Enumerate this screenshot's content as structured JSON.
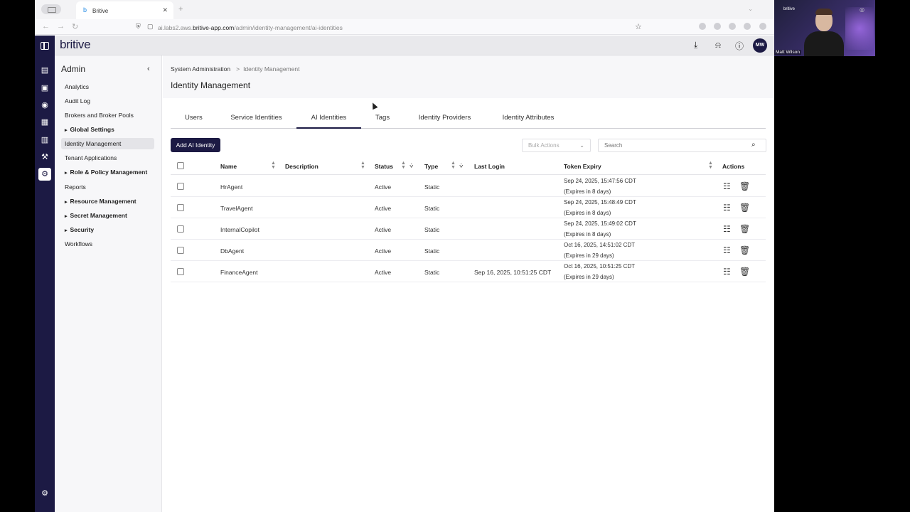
{
  "browser": {
    "tab_title": "Britive",
    "url_prefix": "ai.labs2.aws.",
    "url_domain": "britive-app.com",
    "url_path": "/admin/identity-management/ai-identities"
  },
  "app": {
    "logo": "britive",
    "user_initials": "MW"
  },
  "sidebar": {
    "title": "Admin",
    "items": [
      {
        "label": "Analytics"
      },
      {
        "label": "Audit Log"
      },
      {
        "label": "Brokers and Broker Pools"
      },
      {
        "label": "Global Settings"
      },
      {
        "label": "Identity Management"
      },
      {
        "label": "Tenant Applications"
      },
      {
        "label": "Role & Policy Management"
      },
      {
        "label": "Reports"
      },
      {
        "label": "Resource Management"
      },
      {
        "label": "Secret Management"
      },
      {
        "label": "Security"
      },
      {
        "label": "Workflows"
      }
    ]
  },
  "breadcrumb": {
    "parent": "System Administration",
    "separator": ">",
    "current": "Identity Management"
  },
  "page_title": "Identity Management",
  "tabs": [
    {
      "label": "Users"
    },
    {
      "label": "Service Identities"
    },
    {
      "label": "AI Identities"
    },
    {
      "label": "Tags"
    },
    {
      "label": "Identity Providers"
    },
    {
      "label": "Identity Attributes"
    }
  ],
  "toolbar": {
    "add_label": "Add AI Identity",
    "bulk_label": "Bulk Actions",
    "search_placeholder": "Search"
  },
  "table": {
    "headers": {
      "name": "Name",
      "description": "Description",
      "status": "Status",
      "type": "Type",
      "last_login": "Last Login",
      "token_expiry": "Token Expiry",
      "actions": "Actions"
    },
    "rows": [
      {
        "name": "HrAgent",
        "description": "",
        "status": "Active",
        "type": "Static",
        "last_login": "",
        "expiry": "Sep 24, 2025, 15:47:56 CDT",
        "expiry_note": "(Expires in 8 days)"
      },
      {
        "name": "TravelAgent",
        "description": "",
        "status": "Active",
        "type": "Static",
        "last_login": "",
        "expiry": "Sep 24, 2025, 15:48:49 CDT",
        "expiry_note": "(Expires in 8 days)"
      },
      {
        "name": "InternalCopilot",
        "description": "",
        "status": "Active",
        "type": "Static",
        "last_login": "",
        "expiry": "Sep 24, 2025, 15:49:02 CDT",
        "expiry_note": "(Expires in 8 days)"
      },
      {
        "name": "DbAgent",
        "description": "",
        "status": "Active",
        "type": "Static",
        "last_login": "",
        "expiry": "Oct 16, 2025, 14:51:02 CDT",
        "expiry_note": "(Expires in 29 days)"
      },
      {
        "name": "FinanceAgent",
        "description": "",
        "status": "Active",
        "type": "Static",
        "last_login": "Sep 16, 2025, 10:51:25 CDT",
        "expiry": "Oct 16, 2025, 10:51:25 CDT",
        "expiry_note": "(Expires in 29 days)"
      }
    ]
  },
  "webcam": {
    "brand": "britive",
    "participant": "Matt Wilson"
  }
}
